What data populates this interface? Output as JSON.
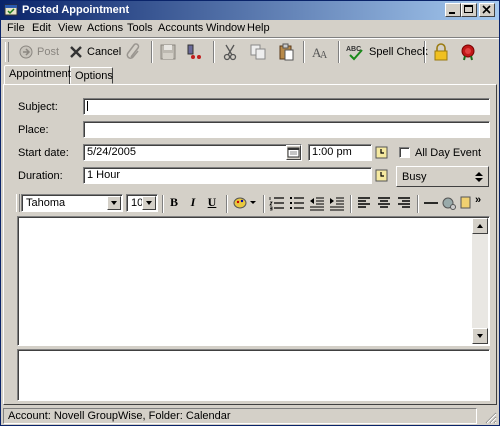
{
  "window": {
    "title": "Posted Appointment"
  },
  "menu": [
    "File",
    "Edit",
    "View",
    "Actions",
    "Tools",
    "Accounts",
    "Window",
    "Help"
  ],
  "toolbar": {
    "post_label": "Post",
    "cancel_label": "Cancel",
    "spell_label": "Spell Check",
    "spell_icon_text": "ABC"
  },
  "tabs": [
    "Appointment",
    "Options"
  ],
  "form": {
    "subject_label": "Subject:",
    "subject_value": "",
    "place_label": "Place:",
    "place_value": "",
    "start_label": "Start date:",
    "start_date": "5/24/2005",
    "start_time": "1:00 pm",
    "allday_label": "All Day Event",
    "duration_label": "Duration:",
    "duration_value": "1 Hour",
    "busy_value": "Busy"
  },
  "format": {
    "font": "Tahoma",
    "size": "10",
    "bold": "B",
    "italic": "I",
    "underline": "U"
  },
  "status": {
    "text": "Account: Novell GroupWise,  Folder: Calendar"
  }
}
